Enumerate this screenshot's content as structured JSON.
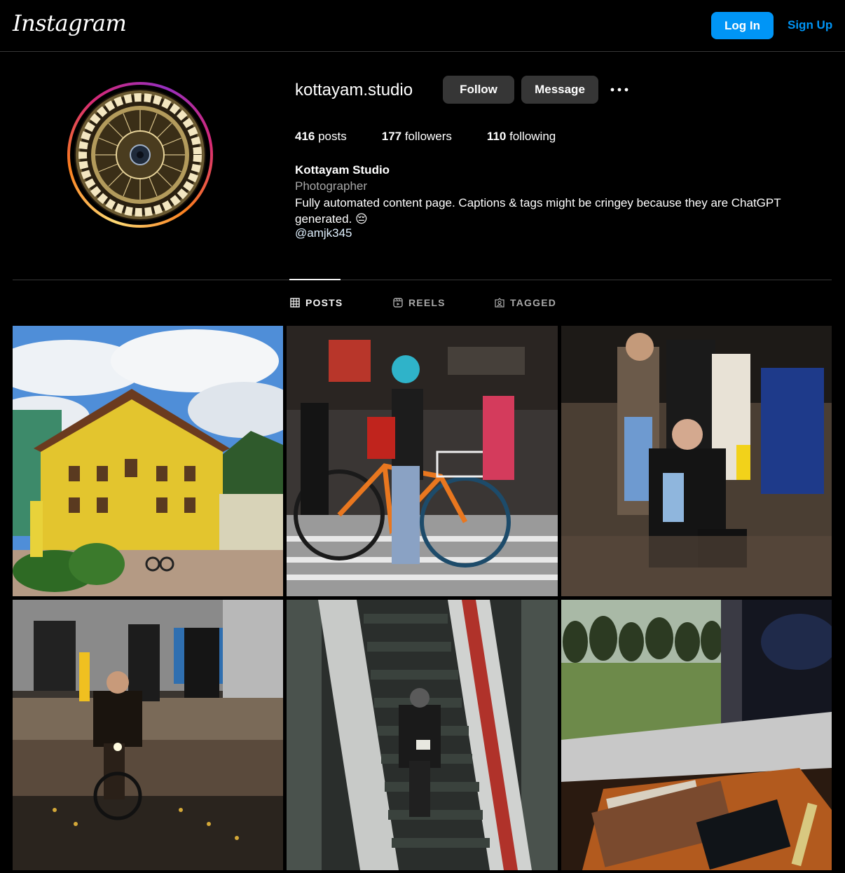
{
  "header": {
    "logo_text": "Instagram",
    "login_label": "Log In",
    "signup_label": "Sign Up"
  },
  "profile": {
    "username": "kottayam.studio",
    "follow_label": "Follow",
    "message_label": "Message",
    "more_icon": "more-horizontal-icon",
    "stats": {
      "posts_count": "416",
      "posts_label": " posts",
      "followers_count": "177",
      "followers_label": " followers",
      "following_count": "110",
      "following_label": " following"
    },
    "full_name": "Kottayam Studio",
    "category": "Photographer",
    "bio": "Fully automated content page. Captions & tags might be cringey because they are ChatGPT generated. 😔",
    "handle": "@amjk345"
  },
  "tabs": [
    {
      "label": "POSTS",
      "icon": "grid-icon",
      "active": true
    },
    {
      "label": "REELS",
      "icon": "reels-icon",
      "active": false
    },
    {
      "label": "TAGGED",
      "icon": "tagged-icon",
      "active": false
    }
  ],
  "colors": {
    "accent": "#0095f6",
    "button_bg": "#363636",
    "muted_text": "#a8a8a8"
  }
}
